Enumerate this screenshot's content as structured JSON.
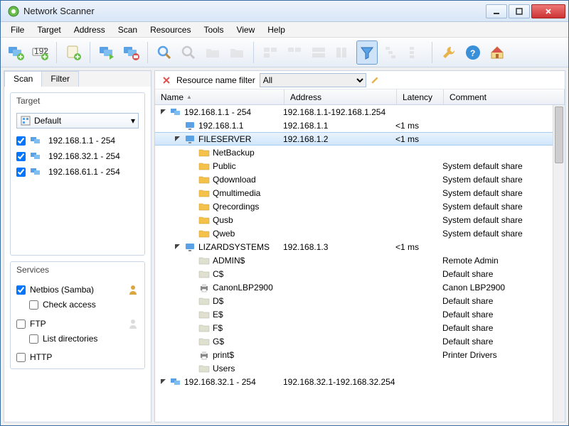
{
  "title": "Network Scanner",
  "menu": [
    "File",
    "Target",
    "Address",
    "Scan",
    "Resources",
    "Tools",
    "View",
    "Help"
  ],
  "tabs": {
    "scan": "Scan",
    "filter": "Filter"
  },
  "target": {
    "label": "Target",
    "combo": "Default",
    "ranges": [
      "192.168.1.1 - 254",
      "192.168.32.1 - 254",
      "192.168.61.1 - 254"
    ]
  },
  "services": {
    "label": "Services",
    "netbios": "Netbios (Samba)",
    "checkaccess": "Check access",
    "ftp": "FTP",
    "listdirs": "List directories",
    "http": "HTTP"
  },
  "filter": {
    "label": "Resource name filter",
    "value": "All"
  },
  "columns": {
    "name": "Name",
    "address": "Address",
    "latency": "Latency",
    "comment": "Comment"
  },
  "rows": [
    {
      "d": 0,
      "exp": "open",
      "icon": "net",
      "name": "192.168.1.1 - 254",
      "addr": "192.168.1.1-192.168.1.254",
      "lat": "",
      "com": ""
    },
    {
      "d": 1,
      "exp": "none",
      "icon": "mon",
      "name": "192.168.1.1",
      "addr": "192.168.1.1",
      "lat": "<1 ms",
      "com": ""
    },
    {
      "d": 1,
      "exp": "open",
      "icon": "mon",
      "name": "FILESERVER",
      "addr": "192.168.1.2",
      "lat": "<1 ms",
      "com": "",
      "sel": true
    },
    {
      "d": 2,
      "exp": "none",
      "icon": "fo",
      "name": "NetBackup",
      "addr": "",
      "lat": "",
      "com": ""
    },
    {
      "d": 2,
      "exp": "none",
      "icon": "fo",
      "name": "Public",
      "addr": "",
      "lat": "",
      "com": "System default share"
    },
    {
      "d": 2,
      "exp": "none",
      "icon": "fo",
      "name": "Qdownload",
      "addr": "",
      "lat": "",
      "com": "System default share"
    },
    {
      "d": 2,
      "exp": "none",
      "icon": "fo",
      "name": "Qmultimedia",
      "addr": "",
      "lat": "",
      "com": "System default share"
    },
    {
      "d": 2,
      "exp": "none",
      "icon": "fo",
      "name": "Qrecordings",
      "addr": "",
      "lat": "",
      "com": "System default share"
    },
    {
      "d": 2,
      "exp": "none",
      "icon": "fo",
      "name": "Qusb",
      "addr": "",
      "lat": "",
      "com": "System default share"
    },
    {
      "d": 2,
      "exp": "none",
      "icon": "fo",
      "name": "Qweb",
      "addr": "",
      "lat": "",
      "com": "System default share"
    },
    {
      "d": 1,
      "exp": "open",
      "icon": "mon",
      "name": "LIZARDSYSTEMS",
      "addr": "192.168.1.3",
      "lat": "<1 ms",
      "com": ""
    },
    {
      "d": 2,
      "exp": "none",
      "icon": "fg",
      "name": "ADMIN$",
      "addr": "",
      "lat": "",
      "com": "Remote Admin"
    },
    {
      "d": 2,
      "exp": "none",
      "icon": "fg",
      "name": "C$",
      "addr": "",
      "lat": "",
      "com": "Default share"
    },
    {
      "d": 2,
      "exp": "none",
      "icon": "pr",
      "name": "CanonLBP2900",
      "addr": "",
      "lat": "",
      "com": "Canon LBP2900"
    },
    {
      "d": 2,
      "exp": "none",
      "icon": "fg",
      "name": "D$",
      "addr": "",
      "lat": "",
      "com": "Default share"
    },
    {
      "d": 2,
      "exp": "none",
      "icon": "fg",
      "name": "E$",
      "addr": "",
      "lat": "",
      "com": "Default share"
    },
    {
      "d": 2,
      "exp": "none",
      "icon": "fg",
      "name": "F$",
      "addr": "",
      "lat": "",
      "com": "Default share"
    },
    {
      "d": 2,
      "exp": "none",
      "icon": "fg",
      "name": "G$",
      "addr": "",
      "lat": "",
      "com": "Default share"
    },
    {
      "d": 2,
      "exp": "none",
      "icon": "pr",
      "name": "print$",
      "addr": "",
      "lat": "",
      "com": "Printer Drivers"
    },
    {
      "d": 2,
      "exp": "none",
      "icon": "fg",
      "name": "Users",
      "addr": "",
      "lat": "",
      "com": ""
    },
    {
      "d": 0,
      "exp": "open",
      "icon": "net",
      "name": "192.168.32.1 - 254",
      "addr": "192.168.32.1-192.168.32.254",
      "lat": "",
      "com": ""
    }
  ]
}
